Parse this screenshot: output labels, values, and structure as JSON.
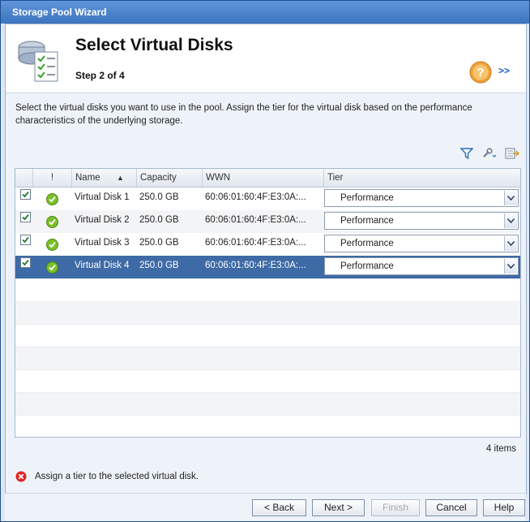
{
  "window": {
    "title": "Storage Pool Wizard"
  },
  "header": {
    "title": "Select Virtual Disks",
    "step": "Step 2 of 4",
    "expand": ">>"
  },
  "instructions": "Select the virtual disks you want to use in the pool. Assign the tier for the virtual disk based on the performance characteristics of the underlying storage.",
  "table": {
    "columns": [
      "!",
      "Name",
      "Capacity",
      "WWN",
      "Tier"
    ],
    "sort_indicator": "▲",
    "rows": [
      {
        "checked": true,
        "status": "ok",
        "name": "Virtual Disk 1",
        "capacity": "250.0 GB",
        "wwn": "60:06:01:60:4F:E3:0A:...",
        "tier": "Performance",
        "selected": false
      },
      {
        "checked": true,
        "status": "ok",
        "name": "Virtual Disk 2",
        "capacity": "250.0 GB",
        "wwn": "60:06:01:60:4F:E3:0A:...",
        "tier": "Performance",
        "selected": false
      },
      {
        "checked": true,
        "status": "ok",
        "name": "Virtual Disk 3",
        "capacity": "250.0 GB",
        "wwn": "60:06:01:60:4F:E3:0A:...",
        "tier": "Performance",
        "selected": false
      },
      {
        "checked": true,
        "status": "ok",
        "name": "Virtual Disk 4",
        "capacity": "250.0 GB",
        "wwn": "60:06:01:60:4F:E3:0A:...",
        "tier": "Performance",
        "selected": true
      }
    ],
    "count": "4 items"
  },
  "error": {
    "message": "Assign a tier to the selected virtual disk."
  },
  "buttons": {
    "back": "< Back",
    "next": "Next >",
    "finish": "Finish",
    "cancel": "Cancel",
    "help": "Help"
  },
  "icons": {
    "filter": "filter-icon",
    "tools": "wrench-icon",
    "export": "export-icon",
    "help": "help-question-icon",
    "status_ok": "checkmark-ok-icon",
    "error": "error-x-icon"
  },
  "colors": {
    "titlebar": "#3c74c0",
    "selected_row": "#3e6aa6",
    "link": "#1b62c4",
    "error": "#e02424",
    "ok": "#7bbf2a"
  }
}
